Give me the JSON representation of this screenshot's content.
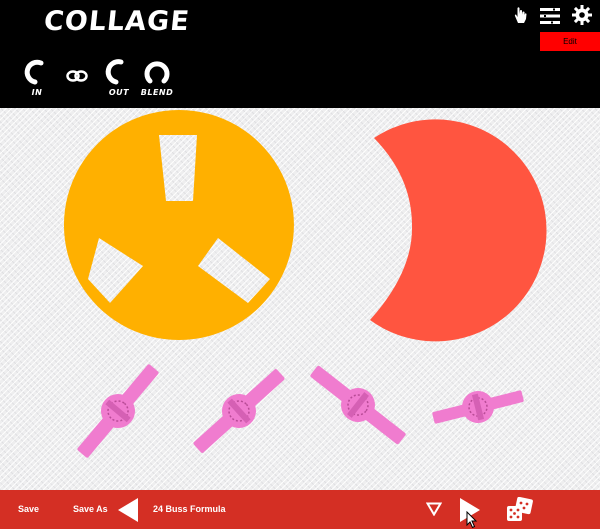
{
  "header": {
    "logo": "COLLAGE",
    "edit_label": "Edit",
    "knobs": [
      {
        "label": "IN"
      },
      {
        "label": "OUT"
      },
      {
        "label": "BLEND"
      }
    ]
  },
  "footer": {
    "save_label": "Save",
    "save_as_label": "Save As",
    "preset_name": "24 Buss Formula"
  },
  "colors": {
    "header_bg": "#000000",
    "edit_button": "#ff0000",
    "footer_bg": "#d42f24",
    "reel": "#ffb000",
    "moon": "#ff5540",
    "slider": "#f07ccf"
  }
}
